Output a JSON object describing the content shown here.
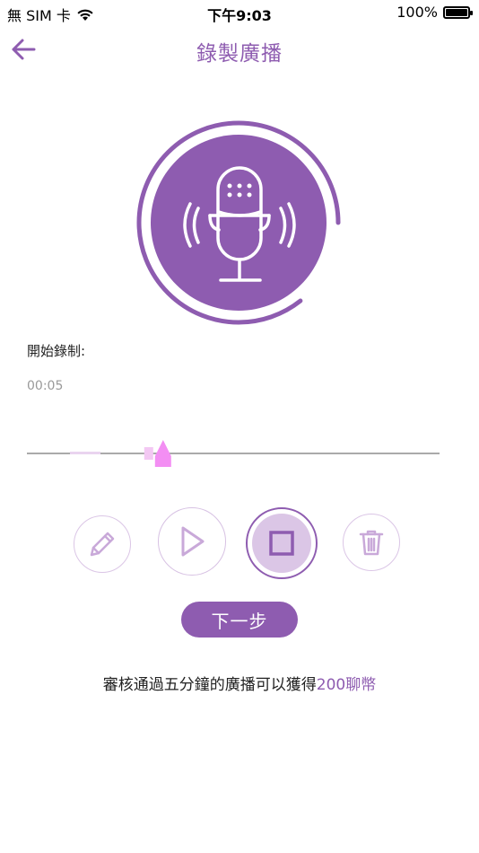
{
  "status_bar": {
    "carrier": "無 SIM 卡",
    "time": "下午9:03",
    "battery": "100%",
    "battery_level": 1.0
  },
  "nav": {
    "title": "錄製廣播",
    "back_icon": "arrow-left-icon"
  },
  "recording": {
    "label": "開始錄制:",
    "elapsed": "00:05",
    "progress": 0.33
  },
  "controls": {
    "edit_icon": "pencil-icon",
    "play_icon": "play-icon",
    "stop_icon": "stop-icon",
    "delete_icon": "trash-icon"
  },
  "next_button": {
    "label": "下一步"
  },
  "notice": {
    "text": "審核通過五分鐘的廣播可以獲得",
    "highlight": "200聊幣"
  },
  "colors": {
    "accent": "#8e5cb0",
    "accent_light": "#dbc6e6",
    "marker": "#f38ef3"
  }
}
